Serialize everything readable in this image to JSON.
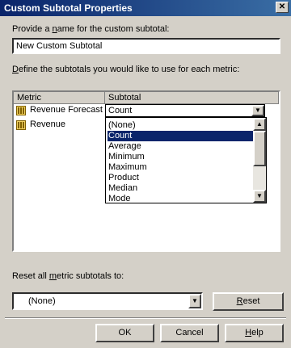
{
  "window": {
    "title": "Custom Subtotal Properties",
    "close_glyph": "✕"
  },
  "name_section": {
    "label_prefix": "Provide a ",
    "label_underlined": "n",
    "label_suffix": "ame for the custom subtotal:",
    "value": "New Custom Subtotal"
  },
  "define_section": {
    "label_underlined": "D",
    "label_rest": "efine the subtotals you would like to use for each metric:"
  },
  "grid": {
    "columns": [
      "Metric",
      "Subtotal"
    ],
    "rows": [
      {
        "metric": "Revenue Forecast",
        "subtotal": "Count"
      },
      {
        "metric": "Revenue",
        "subtotal": ""
      }
    ]
  },
  "dropdown": {
    "options": [
      "(None)",
      "Count",
      "Average",
      "Minimum",
      "Maximum",
      "Product",
      "Median",
      "Mode"
    ],
    "selected": "Count"
  },
  "reset_section": {
    "label_prefix": "Reset all ",
    "label_underlined": "m",
    "label_suffix": "etric subtotals to:",
    "selected_value": "(None)",
    "reset_underlined": "R",
    "reset_rest": "eset"
  },
  "footer": {
    "ok": "OK",
    "cancel": "Cancel",
    "help_underlined": "H",
    "help_rest": "elp"
  }
}
